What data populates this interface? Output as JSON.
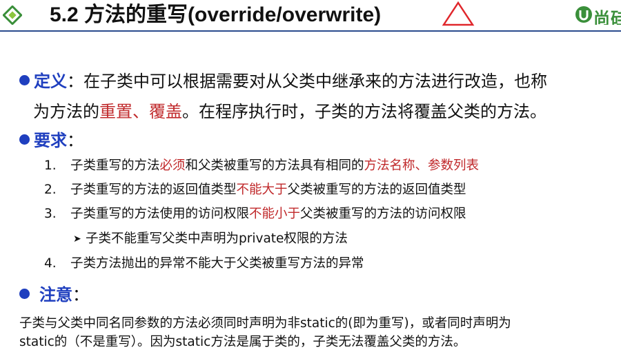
{
  "header": {
    "title": "5.2  方法的重写(override/overwrite)",
    "brand_text": "尚硅",
    "colors": {
      "accent_blue": "#1f3fbf",
      "highlight_red": "#c0292b",
      "brand_green": "#3a8f3a",
      "triangle_red": "#e0262b"
    }
  },
  "definition": {
    "label": "定义",
    "colon": "：",
    "line1_text": "在子类中可以根据需要对从父类中继承来的方法进行改造，也称",
    "line2_pre": "为方法的",
    "line2_red": "重置、覆盖",
    "line2_post": "。在程序执行时，子类的方法将覆盖父类的方法。"
  },
  "requirements": {
    "label": "要求",
    "colon": "：",
    "items": [
      {
        "num": "1.",
        "parts": [
          "子类重写的方法",
          "必须",
          "和父类被重写的方法具有相同的",
          "方法名称、参数列表",
          ""
        ]
      },
      {
        "num": "2.",
        "parts": [
          "子类重写的方法的返回值类型",
          "不能大于",
          "父类被重写的方法的返回值类型",
          "",
          ""
        ]
      },
      {
        "num": "3.",
        "parts": [
          "子类重写的方法使用的访问权限",
          "不能小于",
          "父类被重写的方法的访问权限",
          "",
          ""
        ]
      },
      {
        "num": "4.",
        "parts": [
          "子类方法抛出的异常不能大于父类被重写方法的异常",
          "",
          "",
          "",
          ""
        ]
      }
    ],
    "sub_item": "子类不能重写父类中声明为private权限的方法"
  },
  "note": {
    "label": "注意",
    "colon": "：",
    "line1": "子类与父类中同名同参数的方法必须同时声明为非static的(即为重写)，或者同时声明为",
    "line2": "static的（不是重写）。因为static方法是属于类的，子类无法覆盖父类的方法。"
  }
}
